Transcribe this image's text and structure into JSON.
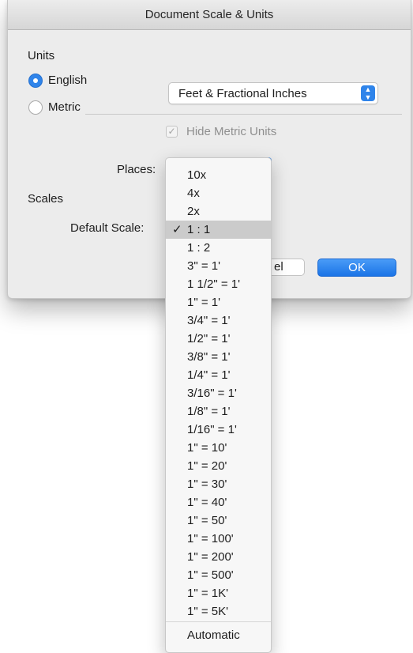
{
  "window": {
    "title": "Document Scale & Units"
  },
  "units": {
    "label": "Units",
    "english_label": "English",
    "metric_label": "Metric",
    "selected": "English",
    "format_value": "Feet & Fractional Inches",
    "hide_metric_label": "Hide Metric Units",
    "hide_metric_checked": true
  },
  "places": {
    "label": "Places:"
  },
  "scales": {
    "label": "Scales",
    "default_scale_label": "Default Scale:",
    "selected": "1 : 1"
  },
  "buttons": {
    "cancel_visible_text": "el",
    "ok_label": "OK"
  },
  "menu": {
    "check_glyph": "✓",
    "items": [
      "10x",
      "4x",
      "2x",
      "1 : 1",
      "1 : 2",
      "3\" = 1'",
      "1 1/2\" = 1'",
      "1\" = 1'",
      "3/4\" = 1'",
      "1/2\" = 1'",
      "3/8\" = 1'",
      "1/4\" = 1'",
      "3/16\" = 1'",
      "1/8\" = 1'",
      "1/16\" = 1'",
      "1\" = 10'",
      "1\" = 20'",
      "1\" = 30'",
      "1\" = 40'",
      "1\" = 50'",
      "1\" = 100'",
      "1\" = 200'",
      "1\" = 500'",
      "1\" = 1K'",
      "1\" = 5K'"
    ],
    "footer": "Automatic"
  }
}
